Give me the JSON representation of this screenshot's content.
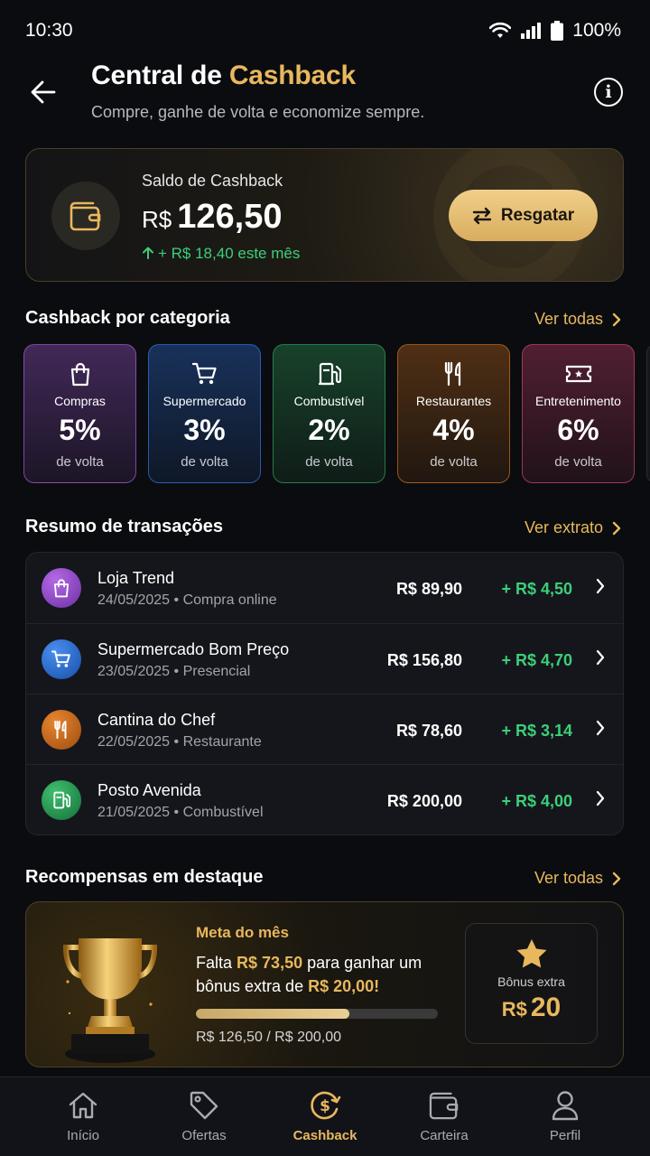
{
  "status_bar": {
    "time": "10:30",
    "battery": "100%"
  },
  "header": {
    "title_prefix": "Central de ",
    "title_highlight": "Cashback",
    "subtitle": "Compre, ganhe de volta e economize sempre."
  },
  "balance": {
    "label": "Saldo de Cashback",
    "currency": "R$",
    "amount": "126,50",
    "delta": "+ R$ 18,40 este mês",
    "redeem_label": "Resgatar"
  },
  "categories_section": {
    "title": "Cashback por categoria",
    "link": "Ver todas",
    "items": [
      {
        "name": "Compras",
        "percent": "5%",
        "caption": "de volta",
        "icon": "bag-icon",
        "color": "#9b59d0"
      },
      {
        "name": "Supermercado",
        "percent": "3%",
        "caption": "de volta",
        "icon": "cart-icon",
        "color": "#2f6fd6"
      },
      {
        "name": "Combustível",
        "percent": "2%",
        "caption": "de volta",
        "icon": "fuel-icon",
        "color": "#2e9a57"
      },
      {
        "name": "Restaurantes",
        "percent": "4%",
        "caption": "de volta",
        "icon": "cutlery-icon",
        "color": "#c06a1e"
      },
      {
        "name": "Entretenimento",
        "percent": "6%",
        "caption": "de volta",
        "icon": "ticket-icon",
        "color": "#c2406a"
      }
    ]
  },
  "transactions_section": {
    "title": "Resumo de transações",
    "link": "Ver extrato",
    "items": [
      {
        "name": "Loja Trend",
        "meta": "24/05/2025 • Compra online",
        "amount": "R$ 89,90",
        "cashback": "+ R$ 4,50",
        "icon": "bag-icon",
        "color": "#8e44c9"
      },
      {
        "name": "Supermercado Bom Preço",
        "meta": "23/05/2025 • Presencial",
        "amount": "R$ 156,80",
        "cashback": "+ R$ 4,70",
        "icon": "cart-icon",
        "color": "#1f63c7"
      },
      {
        "name": "Cantina do Chef",
        "meta": "22/05/2025 • Restaurante",
        "amount": "R$ 78,60",
        "cashback": "+ R$ 3,14",
        "icon": "cutlery-icon",
        "color": "#c2651a"
      },
      {
        "name": "Posto Avenida",
        "meta": "21/05/2025 • Combustível",
        "amount": "R$ 200,00",
        "cashback": "+ R$ 4,00",
        "icon": "fuel-icon",
        "color": "#23904c"
      }
    ]
  },
  "rewards_section": {
    "title": "Recompensas em destaque",
    "link": "Ver todas",
    "goal_title": "Meta do mês",
    "text_1": "Falta ",
    "missing": "R$ 73,50",
    "text_2": " para ganhar um bônus extra de ",
    "bonus_amount": "R$ 20,00!",
    "progress_text": "R$ 126,50 / R$ 200,00",
    "progress_fraction": 0.6325,
    "bonus_label": "Bônus extra",
    "bonus_currency": "R$",
    "bonus_value": "20"
  },
  "bottom_nav": {
    "items": [
      {
        "label": "Início",
        "icon": "home-icon",
        "active": false
      },
      {
        "label": "Ofertas",
        "icon": "tag-icon",
        "active": false
      },
      {
        "label": "Cashback",
        "icon": "cashback-icon",
        "active": true
      },
      {
        "label": "Carteira",
        "icon": "wallet-icon",
        "active": false
      },
      {
        "label": "Perfil",
        "icon": "user-icon",
        "active": false
      }
    ]
  },
  "colors": {
    "accent": "#e8b85d",
    "positive": "#3ccf7a",
    "background": "#0b0c0f"
  }
}
